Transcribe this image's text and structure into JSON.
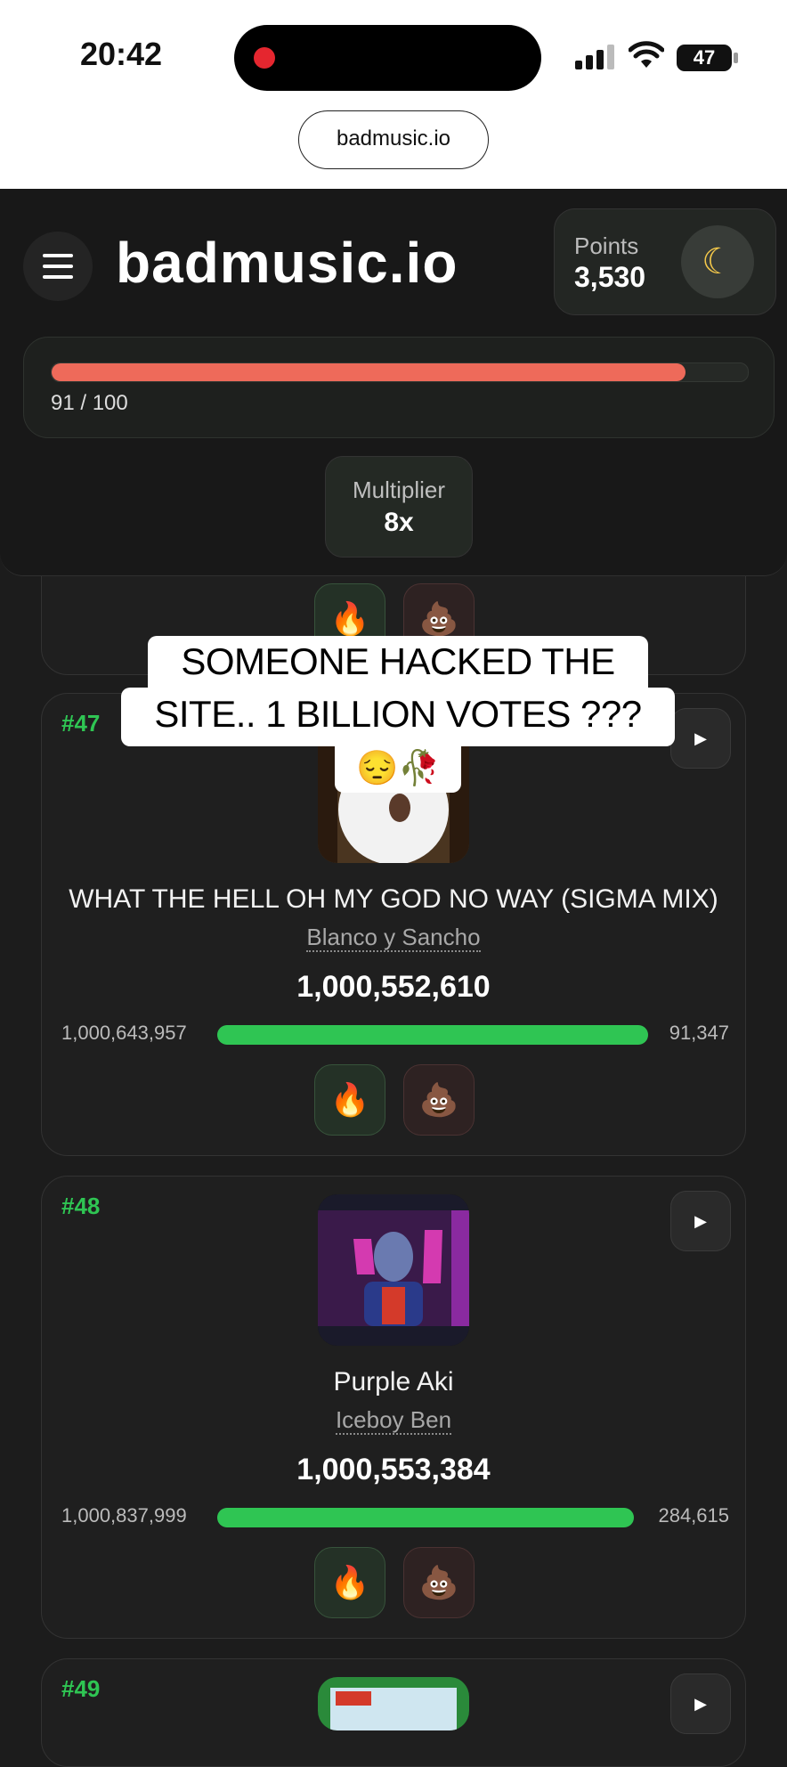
{
  "status_bar": {
    "time": "20:42",
    "battery": "47",
    "url": "badmusic.io"
  },
  "header": {
    "logo": "badmusic.io",
    "menu_icon": "hamburger-menu-icon",
    "points_label": "Points",
    "points_value": "3,530",
    "theme_icon": "moon-icon",
    "progress_text": "91 / 100",
    "progress_fraction": 0.91,
    "multiplier_label": "Multiplier",
    "multiplier_value": "8x"
  },
  "caption": {
    "line1": "SOMEONE HACKED THE",
    "line2": "SITE.. 1 BILLION VOTES ???",
    "line3": "😔🥀"
  },
  "songs": [
    {
      "rank": "#47",
      "title": "WHAT THE HELL OH MY GOD NO WAY (SIGMA MIX)",
      "artist": "Blanco y Sancho",
      "score": "1,000,552,610",
      "votes_left": "1,000,643,957",
      "votes_right": "91,347",
      "fill_fraction": 1.0
    },
    {
      "rank": "#48",
      "title": "Purple Aki",
      "artist": "Iceboy Ben",
      "score": "1,000,553,384",
      "votes_left": "1,000,837,999",
      "votes_right": "284,615",
      "fill_fraction": 1.0
    },
    {
      "rank": "#49"
    }
  ],
  "reactions": {
    "fire": "🔥",
    "poop": "💩"
  },
  "play_symbol": "▶",
  "colors": {
    "accent_green": "#2fc553",
    "progress_red": "#ee6a5a",
    "background": "#1c1c1c"
  }
}
